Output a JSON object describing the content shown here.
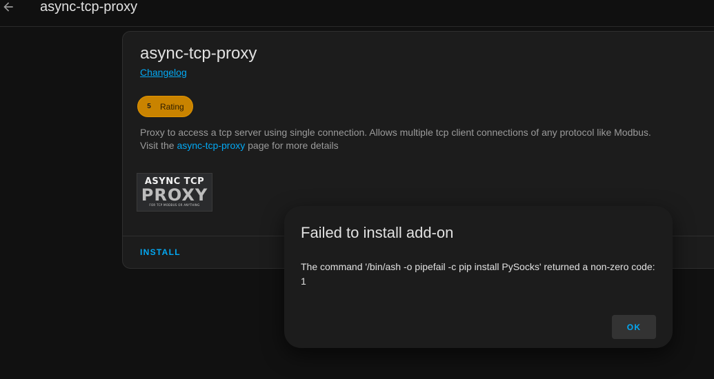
{
  "header": {
    "title": "async-tcp-proxy",
    "back_icon": "arrow-left-icon"
  },
  "addon": {
    "name": "async-tcp-proxy",
    "changelog_label": "Changelog",
    "rating": {
      "value": "5",
      "label": "Rating",
      "color": "#c98300"
    },
    "description_part1": "Proxy to access a tcp server using single connection. Allows multiple tcp client connections of any protocol like Modbus.",
    "description_part2": "Visit the ",
    "description_link": "async-tcp-proxy",
    "description_part3": " page for more details",
    "logo": {
      "line1": "ASYNC TCP",
      "line2": "PROXY",
      "line3": "FOR TCP MODBUS OR ANYTHING"
    },
    "install_label": "INSTALL"
  },
  "dialog": {
    "title": "Failed to install add-on",
    "message": "The command '/bin/ash -o pipefail -c pip install PySocks' returned a non-zero code: 1",
    "ok_label": "OK"
  },
  "colors": {
    "accent": "#03a9f4",
    "background": "#111111",
    "card": "#1c1c1c"
  }
}
